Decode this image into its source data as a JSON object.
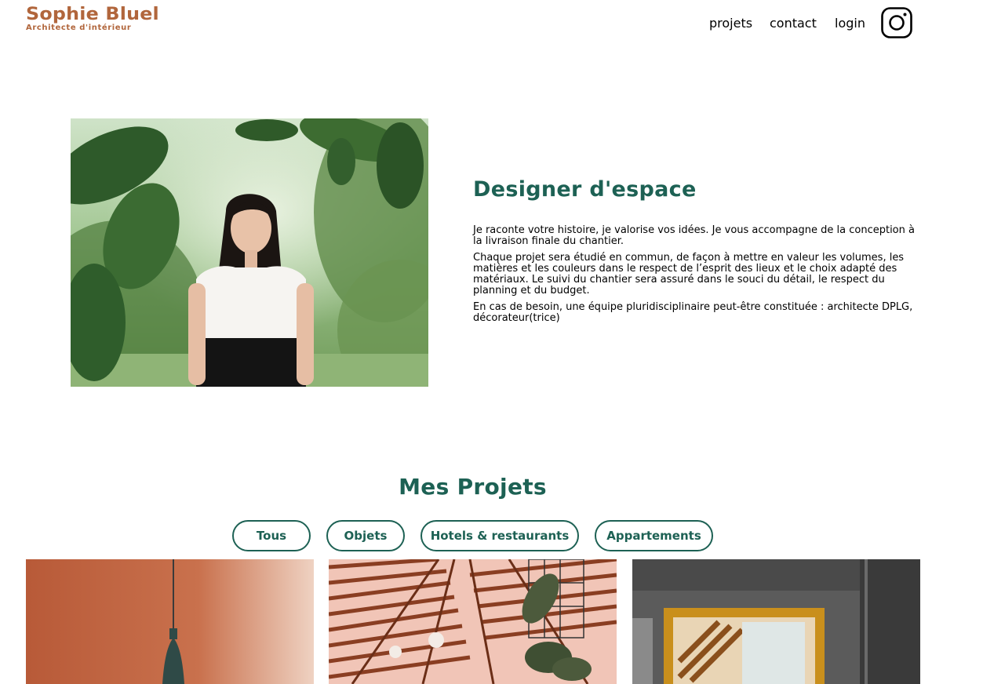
{
  "header": {
    "logo_name": "Sophie Bluel",
    "logo_subtitle": "Architecte d'intérieur",
    "nav": {
      "projets": "projets",
      "contact": "contact",
      "login": "login"
    },
    "instagram_icon": "instagram-icon"
  },
  "intro": {
    "photo": "portrait photo of the architect among green foliage",
    "title": "Designer d'espace",
    "paragraphs": [
      "Je raconte votre histoire, je valorise vos idées. Je vous accompagne de la conception à la livraison finale du chantier.",
      "Chaque projet sera étudié en commun, de façon à mettre en valeur les volumes, les matières et les couleurs dans le respect de l’esprit des lieux et le choix adapté des matériaux. Le suivi du chantier sera assuré dans le souci du détail, le respect du planning et du budget.",
      "En cas de besoin, une équipe pluridisciplinaire peut-être constituée : architecte DPLG, décorateur(trice)"
    ]
  },
  "projects": {
    "title": "Mes Projets",
    "filters": [
      "Tous",
      "Objets",
      "Hotels & restaurants",
      "Appartements"
    ]
  },
  "colors": {
    "brand": "#B1663C",
    "accent": "#1D6154"
  }
}
